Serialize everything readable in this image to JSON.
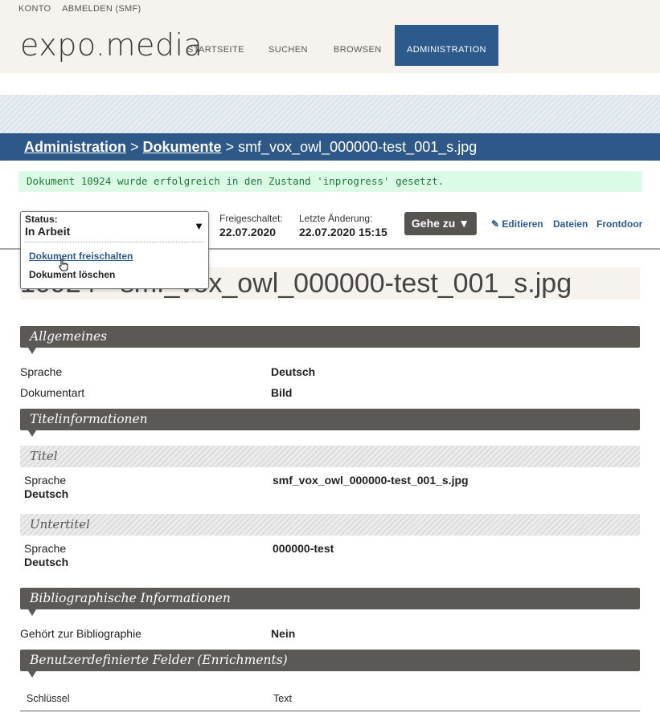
{
  "account": {
    "konto": "KONTO",
    "logout": "ABMELDEN (SMF)"
  },
  "logo": "expo.media",
  "nav": {
    "home": "STARTSEITE",
    "search": "SUCHEN",
    "browse": "BROWSEN",
    "admin": "ADMINISTRATION"
  },
  "breadcrumb": {
    "part1": "Administration",
    "sep1": " > ",
    "part2": "Dokumente",
    "sep2": " > ",
    "current": "smf_vox_owl_000000-test_001_s.jpg"
  },
  "message": "Dokument 10924 wurde erfolgreich in den Zustand 'inprogress' gesetzt.",
  "status": {
    "label": "Status:",
    "current": "In Arbeit",
    "options": [
      "Dokument freischalten",
      "Dokument löschen"
    ]
  },
  "meta": {
    "published_label": "Freigeschaltet:",
    "published_value": "22.07.2020",
    "changed_label": "Letzte Änderung:",
    "changed_value": "22.07.2020 15:15"
  },
  "actions": {
    "goto": "Gehe zu ▼",
    "edit": "Editieren",
    "files": "Dateien",
    "frontdoor": "Frontdoor"
  },
  "document_heading": "10924 - smf_vox_owl_000000-test_001_s.jpg",
  "sections": {
    "general": {
      "title": "Allgemeines",
      "language_label": "Sprache",
      "language_value": "Deutsch",
      "doctype_label": "Dokumentart",
      "doctype_value": "Bild"
    },
    "titleinfo": {
      "title": "Titelinformationen",
      "main_title_head": "Titel",
      "main_lang_label": "Sprache",
      "main_lang_value": "Deutsch",
      "main_value": "smf_vox_owl_000000-test_001_s.jpg",
      "subtitle_head": "Untertitel",
      "sub_lang_label": "Sprache",
      "sub_lang_value": "Deutsch",
      "sub_value": "000000-test"
    },
    "biblio": {
      "title": "Bibliographische Informationen",
      "belongs_label": "Gehört zur Bibliographie",
      "belongs_value": "Nein"
    },
    "enrich": {
      "title": "Benutzerdefinierte Felder (Enrichments)",
      "col_key": "Schlüssel",
      "col_text": "Text"
    }
  }
}
